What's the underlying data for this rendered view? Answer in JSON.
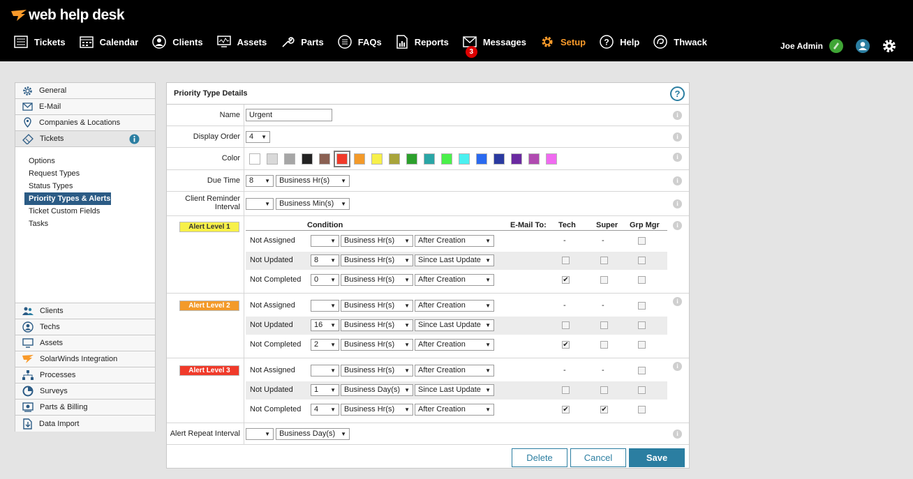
{
  "app": {
    "logo_text": "web help desk"
  },
  "nav": {
    "items": [
      {
        "label": "Tickets",
        "icon": "list-icon"
      },
      {
        "label": "Calendar",
        "icon": "calendar-icon"
      },
      {
        "label": "Clients",
        "icon": "person-icon"
      },
      {
        "label": "Assets",
        "icon": "monitor-icon"
      },
      {
        "label": "Parts",
        "icon": "wrench-icon"
      },
      {
        "label": "FAQs",
        "icon": "faq-list-icon"
      },
      {
        "label": "Reports",
        "icon": "report-icon"
      },
      {
        "label": "Messages",
        "icon": "envelope-icon",
        "badge": "3"
      },
      {
        "label": "Setup",
        "icon": "gear-icon",
        "active": true
      },
      {
        "label": "Help",
        "icon": "question-icon"
      },
      {
        "label": "Thwack",
        "icon": "thwack-icon"
      }
    ]
  },
  "user": {
    "name": "Joe Admin"
  },
  "colors": {
    "accent": "#2b7ea1",
    "active_nav": "#f99a2a",
    "sidebar_selected": "#2b5b85"
  },
  "sidebar": {
    "top_items": [
      {
        "label": "General",
        "icon": "gear-icon"
      },
      {
        "label": "E-Mail",
        "icon": "envelope-icon"
      },
      {
        "label": "Companies & Locations",
        "icon": "location-pin-icon"
      },
      {
        "label": "Tickets",
        "icon": "ticket-icon",
        "selected": true
      }
    ],
    "sub_items": [
      "Options",
      "Request Types",
      "Status Types",
      "Priority Types & Alerts",
      "Ticket Custom Fields",
      "Tasks"
    ],
    "selected_sub": "Priority Types & Alerts",
    "bottom_items": [
      {
        "label": "Clients",
        "icon": "people-icon"
      },
      {
        "label": "Techs",
        "icon": "person-icon"
      },
      {
        "label": "Assets",
        "icon": "monitor-icon"
      },
      {
        "label": "SolarWinds Integration",
        "icon": "solarwinds-icon"
      },
      {
        "label": "Processes",
        "icon": "hierarchy-icon"
      },
      {
        "label": "Surveys",
        "icon": "pie-chart-icon"
      },
      {
        "label": "Parts & Billing",
        "icon": "billing-icon"
      },
      {
        "label": "Data Import",
        "icon": "import-icon"
      }
    ]
  },
  "panel": {
    "title": "Priority Type Details",
    "name_label": "Name",
    "name_value": "Urgent",
    "display_order_label": "Display Order",
    "display_order_value": "4",
    "color_label": "Color",
    "color_swatches": [
      "#ffffff",
      "#d9d9d9",
      "#a6a6a6",
      "#222222",
      "#8a6052",
      "#f03a2a",
      "#f39a2a",
      "#f7f04a",
      "#a8a43a",
      "#2ca02c",
      "#2aa6a6",
      "#4af04a",
      "#4af0f0",
      "#2a6af0",
      "#2a3aa0",
      "#6a2aa0",
      "#b04ab0",
      "#f06af0"
    ],
    "selected_color_index": 5,
    "due_time_label": "Due Time",
    "due_time_value": "8",
    "due_time_unit": "Business Hr(s)",
    "client_reminder_label": "Client Reminder Interval",
    "client_reminder_value": "",
    "client_reminder_unit": "Business Min(s)",
    "alert_repeat_label": "Alert Repeat Interval",
    "alert_repeat_value": "",
    "alert_repeat_unit": "Business Day(s)"
  },
  "alerts_header": {
    "condition": "Condition",
    "email_to": "E-Mail To:",
    "tech": "Tech",
    "super": "Super",
    "grp_mgr": "Grp Mgr"
  },
  "alert_levels": [
    {
      "label": "Alert Level 1",
      "color": "#f7f04a",
      "text_color": "#333333",
      "rows": [
        {
          "condition": "Not Assigned",
          "value": "",
          "unit": "Business Hr(s)",
          "when": "After Creation",
          "tech": null,
          "super": null,
          "grp_mgr": false
        },
        {
          "condition": "Not Updated",
          "value": "8",
          "unit": "Business Hr(s)",
          "when": "Since Last Update",
          "tech": false,
          "super": false,
          "grp_mgr": false
        },
        {
          "condition": "Not Completed",
          "value": "0",
          "unit": "Business Hr(s)",
          "when": "After Creation",
          "tech": true,
          "super": false,
          "grp_mgr": false
        }
      ]
    },
    {
      "label": "Alert Level 2",
      "color": "#f39a2a",
      "text_color": "#ffffff",
      "rows": [
        {
          "condition": "Not Assigned",
          "value": "",
          "unit": "Business Hr(s)",
          "when": "After Creation",
          "tech": null,
          "super": null,
          "grp_mgr": false
        },
        {
          "condition": "Not Updated",
          "value": "16",
          "unit": "Business Hr(s)",
          "when": "Since Last Update",
          "tech": false,
          "super": false,
          "grp_mgr": false
        },
        {
          "condition": "Not Completed",
          "value": "2",
          "unit": "Business Hr(s)",
          "when": "After Creation",
          "tech": true,
          "super": false,
          "grp_mgr": false
        }
      ]
    },
    {
      "label": "Alert Level 3",
      "color": "#f03a2a",
      "text_color": "#ffffff",
      "rows": [
        {
          "condition": "Not Assigned",
          "value": "",
          "unit": "Business Hr(s)",
          "when": "After Creation",
          "tech": null,
          "super": null,
          "grp_mgr": false
        },
        {
          "condition": "Not Updated",
          "value": "1",
          "unit": "Business Day(s)",
          "when": "Since Last Update",
          "tech": false,
          "super": false,
          "grp_mgr": false
        },
        {
          "condition": "Not Completed",
          "value": "4",
          "unit": "Business Hr(s)",
          "when": "After Creation",
          "tech": true,
          "super": true,
          "grp_mgr": false
        }
      ]
    }
  ],
  "buttons": {
    "delete": "Delete",
    "cancel": "Cancel",
    "save": "Save"
  }
}
